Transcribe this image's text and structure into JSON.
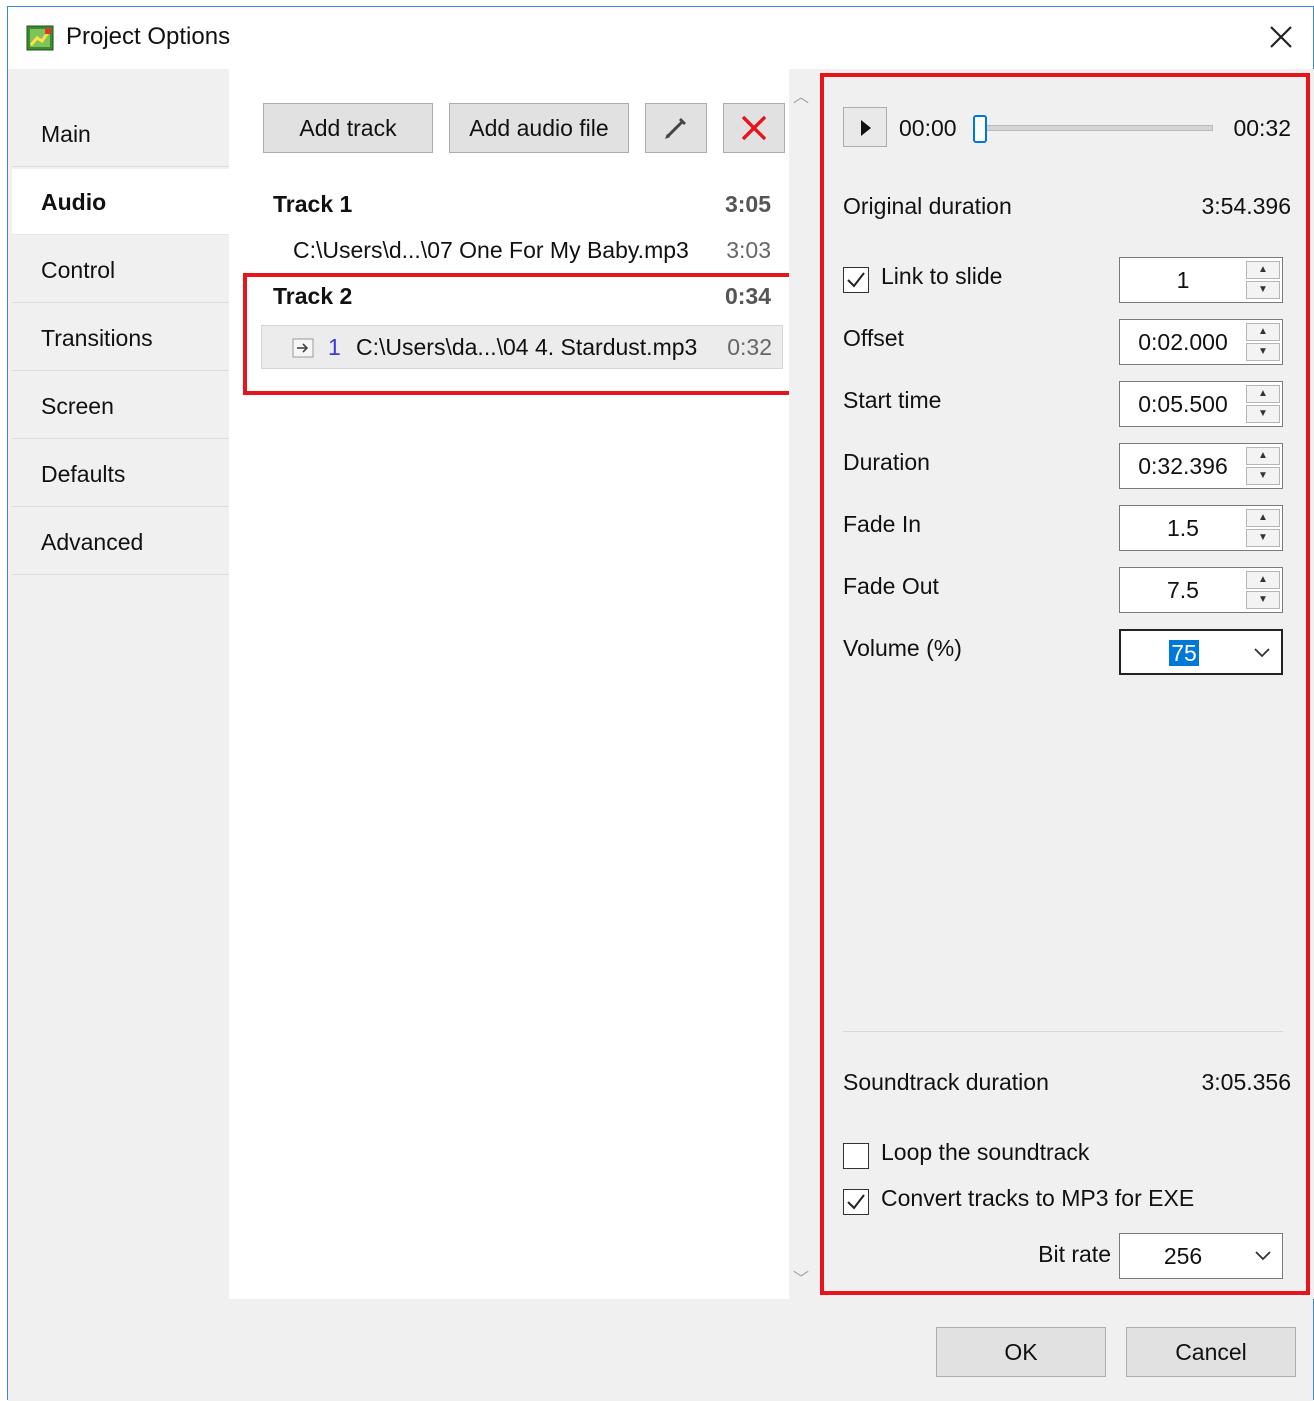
{
  "window": {
    "title": "Project Options"
  },
  "tabs": [
    {
      "label": "Main"
    },
    {
      "label": "Audio"
    },
    {
      "label": "Control"
    },
    {
      "label": "Transitions"
    },
    {
      "label": "Screen"
    },
    {
      "label": "Defaults"
    },
    {
      "label": "Advanced"
    }
  ],
  "active_tab": "Audio",
  "toolbar": {
    "add_track": "Add track",
    "add_audio_file": "Add audio file",
    "edit_icon": "pencil-icon",
    "delete_icon": "close-red-icon"
  },
  "tracks": [
    {
      "title": "Track 1",
      "duration": "3:05",
      "files": [
        {
          "index": "",
          "path": "C:\\Users\\d...\\07 One For  My Baby.mp3",
          "duration": "3:03"
        }
      ]
    },
    {
      "title": "Track 2",
      "duration": "0:34",
      "files": [
        {
          "index": "1",
          "path": "C:\\Users\\da...\\04 4. Stardust.mp3",
          "duration": "0:32",
          "selected": true
        }
      ]
    }
  ],
  "player": {
    "current": "00:00",
    "total": "00:32",
    "progress": 0
  },
  "details": {
    "original_duration_label": "Original duration",
    "original_duration": "3:54.396",
    "link_to_slide_label": "Link to slide",
    "link_to_slide_checked": true,
    "link_to_slide_value": "1",
    "offset_label": "Offset",
    "offset_value": "0:02.000",
    "start_time_label": "Start time",
    "start_time_value": "0:05.500",
    "duration_label": "Duration",
    "duration_value": "0:32.396",
    "fade_in_label": "Fade In",
    "fade_in_value": "1.5",
    "fade_out_label": "Fade Out",
    "fade_out_value": "7.5",
    "volume_label": "Volume (%)",
    "volume_value": "75"
  },
  "soundtrack": {
    "duration_label": "Soundtrack duration",
    "duration": "3:05.356",
    "loop_label": "Loop the soundtrack",
    "loop_checked": false,
    "convert_label": "Convert tracks to MP3 for EXE",
    "convert_checked": true,
    "bit_rate_label": "Bit rate",
    "bit_rate_value": "256"
  },
  "footer": {
    "ok": "OK",
    "cancel": "Cancel"
  },
  "colors": {
    "highlight_red": "#e8141c",
    "selection_blue": "#0078d7",
    "index_blue": "#3a3adf"
  }
}
